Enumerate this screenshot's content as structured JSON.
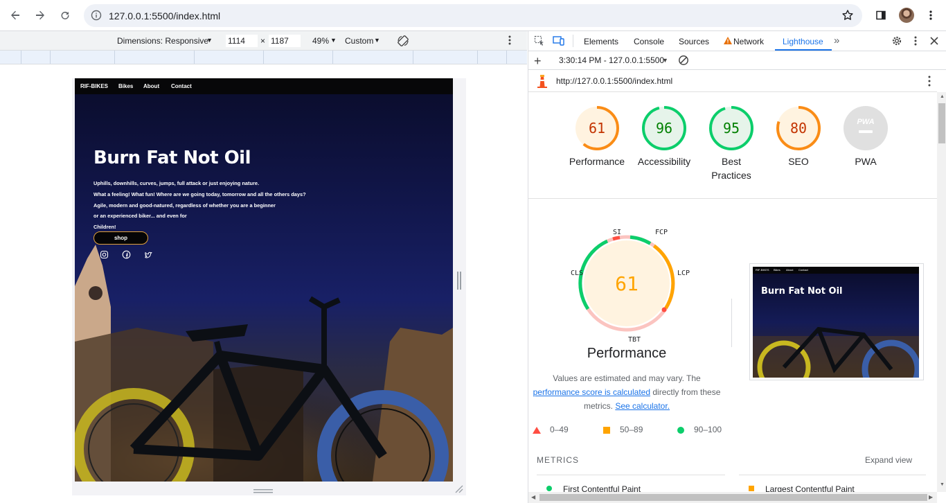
{
  "browser": {
    "url": "127.0.0.1:5500/index.html",
    "icons": [
      "back-icon",
      "forward-icon",
      "reload-icon",
      "info-icon",
      "star-icon",
      "sidepanel-icon",
      "avatar",
      "more-vert-icon"
    ]
  },
  "device_toolbar": {
    "dimensions_label": "Dimensions: Responsive",
    "width_value": "1114",
    "times": "×",
    "height_value": "1187",
    "zoom_label": "49%",
    "throttle_label": "Custom"
  },
  "site": {
    "nav": {
      "brand": "RIF-BIKES",
      "links": [
        "Bikes",
        "About",
        "Contact"
      ]
    },
    "title": "Burn Fat Not Oil",
    "lines": [
      "Uphills, downhills, curves, jumps, full attack or just enjoying nature.",
      "What a feeling! What fun! Where are we going today, tomorrow and all the others days?",
      "Agile, modern and good-natured, regardless of whether you are a beginner",
      "or an experienced biker... and even for",
      "Children!"
    ],
    "shop_label": "shop",
    "social": [
      "instagram-icon",
      "facebook-icon",
      "twitter-icon"
    ]
  },
  "devtools": {
    "tabs": [
      "Elements",
      "Console",
      "Sources",
      "Network",
      "Lighthouse"
    ],
    "active_tab": "Lighthouse",
    "report_time": "3:30:14 PM - 127.0.0.1:5500",
    "report_url": "http://127.0.0.1:5500/index.html"
  },
  "lighthouse": {
    "scores": [
      {
        "label": "Performance",
        "value": "61",
        "color": "#fa8c16",
        "fraction": 0.61
      },
      {
        "label": "Accessibility",
        "value": "96",
        "color": "#0cce6b",
        "fraction": 0.96
      },
      {
        "label": "Best Practices",
        "value": "95",
        "color": "#0cce6b",
        "fraction": 0.95
      },
      {
        "label": "SEO",
        "value": "80",
        "color": "#fa8c16",
        "fraction": 0.8
      },
      {
        "label": "PWA",
        "value": "PWA",
        "color": "#9e9e9e",
        "fraction": 0
      }
    ],
    "big_score": "61",
    "big_label": "Performance",
    "metric_labels": {
      "si": "SI",
      "fcp": "FCP",
      "lcp": "LCP",
      "tbt": "TBT",
      "cls": "CLS"
    },
    "note_before": "Values are estimated and may vary. The",
    "note_link1": "performance score is calculated",
    "note_mid": "directly from these",
    "note_after": "metrics.",
    "note_link2": "See calculator.",
    "legend": [
      {
        "range": "0–49",
        "color": "#ff4e42"
      },
      {
        "range": "50–89",
        "color": "#ffa400"
      },
      {
        "range": "90–100",
        "color": "#0cce6b"
      }
    ],
    "metrics_heading": "METRICS",
    "expand_label": "Expand view",
    "metric_first": "First Contentful Paint",
    "metric_second": "Largest Contentful Paint",
    "thumb": {
      "nav": [
        "RIF-BIKES",
        "Bikes",
        "About",
        "Contact"
      ],
      "title": "Burn Fat Not Oil"
    }
  }
}
